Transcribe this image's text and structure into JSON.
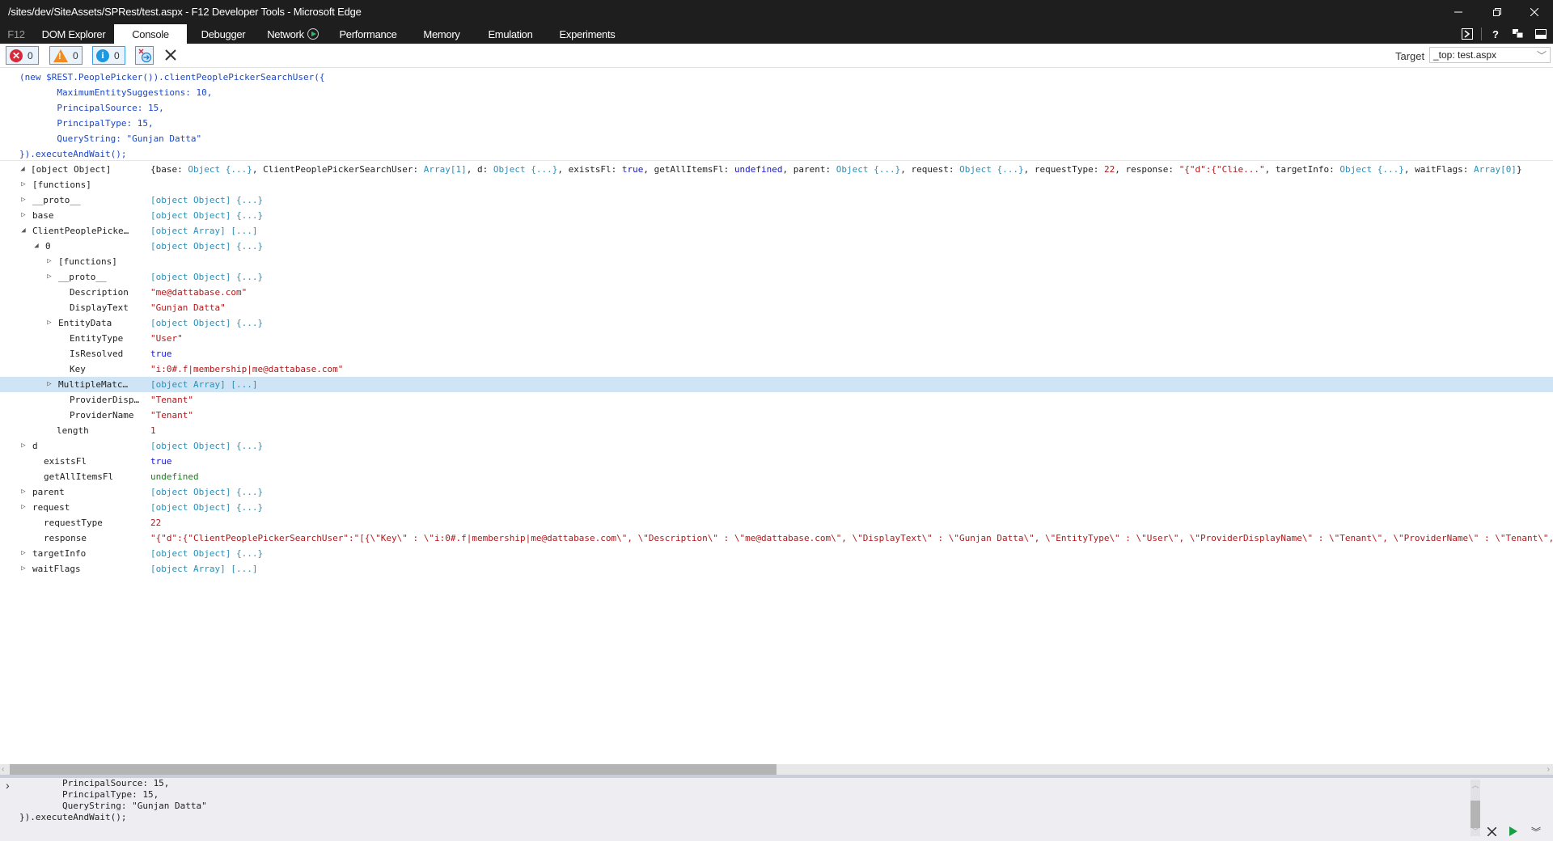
{
  "window": {
    "title": "/sites/dev/SiteAssets/SPRest/test.aspx - F12 Developer Tools - Microsoft Edge",
    "minimize_icon": "minimize-icon",
    "restore_icon": "restore-icon",
    "close_icon": "close-icon"
  },
  "tabs": [
    {
      "label": "F12"
    },
    {
      "label": "DOM Explorer"
    },
    {
      "label": "Console",
      "active": true
    },
    {
      "label": "Debugger"
    },
    {
      "label": "Network",
      "icon": "play-circle-icon"
    },
    {
      "label": "Performance"
    },
    {
      "label": "Memory"
    },
    {
      "label": "Emulation"
    },
    {
      "label": "Experiments"
    }
  ],
  "right_icons": [
    "console-toggle-icon",
    "help-icon",
    "undock-icon",
    "dock-bottom-icon"
  ],
  "toolbar": {
    "errors": "0",
    "warnings": "0",
    "messages": "0",
    "clear_on_navigate_icon": "clear-on-navigate-icon",
    "clear_console_icon": "clear-console-icon",
    "target_label": "Target",
    "target_value": "_top: test.aspx"
  },
  "command": {
    "lines": [
      "(new $REST.PeoplePicker()).clientPeoplePickerSearchUser({",
      "       MaximumEntitySuggestions: 10,",
      "       PrincipalSource: 15,",
      "       PrincipalType: 15,",
      "       QueryString: \"Gunjan Datta\"",
      "}).executeAndWait();"
    ]
  },
  "result": {
    "root_label": "[object Object]",
    "summary": [
      {
        "t": "{base: ",
        "c": "plain"
      },
      {
        "t": "Object {...}",
        "c": "obj"
      },
      {
        "t": ", ClientPeoplePickerSearchUser: ",
        "c": "plain"
      },
      {
        "t": "Array[1]",
        "c": "obj"
      },
      {
        "t": ", d: ",
        "c": "plain"
      },
      {
        "t": "Object {...}",
        "c": "obj"
      },
      {
        "t": ", existsFl: ",
        "c": "plain"
      },
      {
        "t": "true",
        "c": "kw"
      },
      {
        "t": ", getAllItemsFl: ",
        "c": "plain"
      },
      {
        "t": "undefined",
        "c": "kw"
      },
      {
        "t": ", parent: ",
        "c": "plain"
      },
      {
        "t": "Object {...}",
        "c": "obj"
      },
      {
        "t": ", request: ",
        "c": "plain"
      },
      {
        "t": "Object {...}",
        "c": "obj"
      },
      {
        "t": ", requestType: ",
        "c": "plain"
      },
      {
        "t": "22",
        "c": "num"
      },
      {
        "t": ", response: ",
        "c": "plain"
      },
      {
        "t": "\"{\"d\":{\"Clie...\"",
        "c": "str"
      },
      {
        "t": ", targetInfo: ",
        "c": "plain"
      },
      {
        "t": "Object {...}",
        "c": "obj"
      },
      {
        "t": ", waitFlags: ",
        "c": "plain"
      },
      {
        "t": "Array[0]",
        "c": "obj"
      },
      {
        "t": "}",
        "c": "plain"
      }
    ],
    "rows": [
      {
        "depth": 1,
        "twisty": "collapsed",
        "key": "[functions]",
        "key_class": "fn",
        "value": "",
        "value_class": "obj"
      },
      {
        "depth": 1,
        "twisty": "collapsed",
        "key": "__proto__",
        "value": "[object Object] {...}",
        "value_class": "obj"
      },
      {
        "depth": 1,
        "twisty": "collapsed",
        "key": "base",
        "value": "[object Object] {...}",
        "value_class": "obj"
      },
      {
        "depth": 1,
        "twisty": "expanded",
        "key": "ClientPeoplePicke…",
        "value": "[object Array] [...]",
        "value_class": "obj"
      },
      {
        "depth": 2,
        "twisty": "expanded",
        "key": "0",
        "value": "[object Object] {...}",
        "value_class": "obj"
      },
      {
        "depth": 3,
        "twisty": "collapsed",
        "key": "[functions]",
        "key_class": "fn",
        "value": "",
        "value_class": "obj"
      },
      {
        "depth": 3,
        "twisty": "collapsed",
        "key": "__proto__",
        "value": "[object Object] {...}",
        "value_class": "obj"
      },
      {
        "depth": 3,
        "twisty": "none",
        "key": "Description",
        "value": "\"me@dattabase.com\"",
        "value_class": "str"
      },
      {
        "depth": 3,
        "twisty": "none",
        "key": "DisplayText",
        "value": "\"Gunjan Datta\"",
        "value_class": "str"
      },
      {
        "depth": 3,
        "twisty": "collapsed",
        "key": "EntityData",
        "value": "[object Object] {...}",
        "value_class": "obj"
      },
      {
        "depth": 3,
        "twisty": "none",
        "key": "EntityType",
        "value": "\"User\"",
        "value_class": "str"
      },
      {
        "depth": 3,
        "twisty": "none",
        "key": "IsResolved",
        "value": "true",
        "value_class": "kw"
      },
      {
        "depth": 3,
        "twisty": "none",
        "key": "Key",
        "value": "\"i:0#.f|membership|me@dattabase.com\"",
        "value_class": "str"
      },
      {
        "depth": 3,
        "twisty": "collapsed",
        "key": "MultipleMatc…",
        "value": "[object Array] [...]",
        "value_class": "obj",
        "selected": true
      },
      {
        "depth": 3,
        "twisty": "none",
        "key": "ProviderDisp…",
        "value": "\"Tenant\"",
        "value_class": "str"
      },
      {
        "depth": 3,
        "twisty": "none",
        "key": "ProviderName",
        "value": "\"Tenant\"",
        "value_class": "str"
      },
      {
        "depth": 2,
        "twisty": "none",
        "key": "length",
        "value": "1",
        "value_class": "num"
      },
      {
        "depth": 1,
        "twisty": "collapsed",
        "key": "d",
        "value": "[object Object] {...}",
        "value_class": "obj"
      },
      {
        "depth": 1,
        "twisty": "none",
        "key": "existsFl",
        "value": "true",
        "value_class": "kw"
      },
      {
        "depth": 1,
        "twisty": "none",
        "key": "getAllItemsFl",
        "value": "undefined",
        "value_class": "undef"
      },
      {
        "depth": 1,
        "twisty": "collapsed",
        "key": "parent",
        "value": "[object Object] {...}",
        "value_class": "obj"
      },
      {
        "depth": 1,
        "twisty": "collapsed",
        "key": "request",
        "value": "[object Object] {...}",
        "value_class": "obj"
      },
      {
        "depth": 1,
        "twisty": "none",
        "key": "requestType",
        "value": "22",
        "value_class": "num"
      },
      {
        "depth": 1,
        "twisty": "none",
        "key": "response",
        "value": "\"{\"d\":{\"ClientPeoplePickerSearchUser\":\"[{\\\"Key\\\" : \\\"i:0#.f|membership|me@dattabase.com\\\", \\\"Description\\\" : \\\"me@dattabase.com\\\", \\\"DisplayText\\\" : \\\"Gunjan Datta\\\", \\\"EntityType\\\" : \\\"User\\\", \\\"ProviderDisplayName\\\" : \\\"Tenant\\\", \\\"ProviderName\\\" : \\\"Tenant\\\",",
        "value_class": "str"
      },
      {
        "depth": 1,
        "twisty": "collapsed",
        "key": "targetInfo",
        "value": "[object Object] {...}",
        "value_class": "obj"
      },
      {
        "depth": 1,
        "twisty": "collapsed",
        "key": "waitFlags",
        "value": "[object Array] [...]",
        "value_class": "obj"
      }
    ]
  },
  "hscroll": {
    "position_fraction": 0.0,
    "visible_fraction": 0.5
  },
  "input": {
    "prompt": "›",
    "lines": [
      "        PrincipalSource: 15,",
      "        PrincipalType: 15,",
      "        QueryString: \"Gunjan Datta\"",
      "}).executeAndWait();"
    ],
    "clear_icon": "clear-input-icon",
    "run_icon": "run-icon",
    "expand_icon": "expand-input-icon"
  }
}
